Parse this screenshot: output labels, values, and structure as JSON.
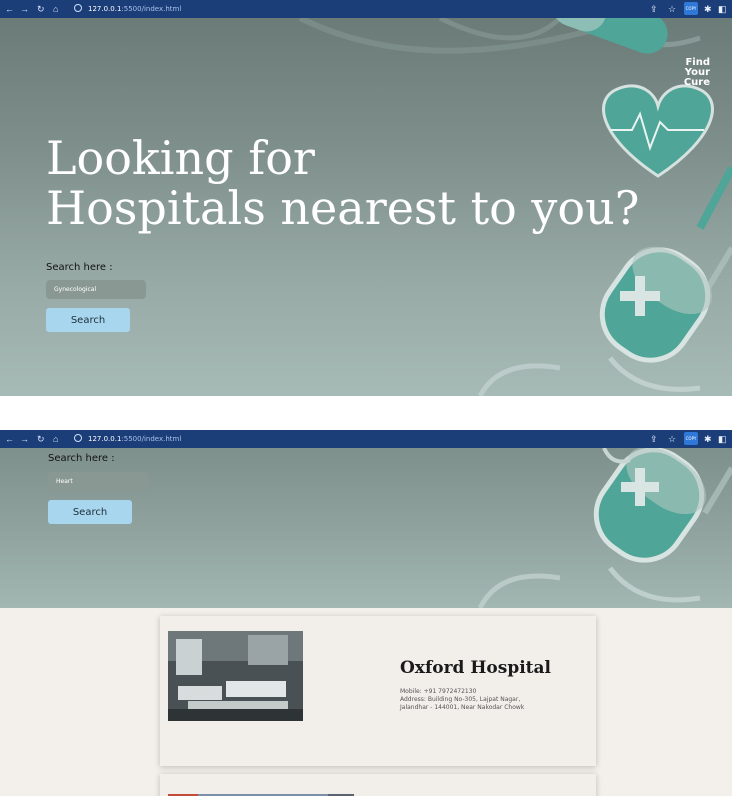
{
  "browser": {
    "url_host": "127.0.0.1",
    "url_path": ":5500/index.html",
    "copy_ext_label": "COPY"
  },
  "brand": {
    "lines": [
      "Find",
      "Your",
      "Cure"
    ]
  },
  "hero": {
    "headline_line1": "Looking for",
    "headline_line2": "Hospitals nearest to you?"
  },
  "search_top": {
    "label": "Search here :",
    "input_value": "Gynecological",
    "button_label": "Search"
  },
  "search_bottom": {
    "label": "Search here :",
    "input_value": "Heart",
    "button_label": "Search"
  },
  "results": [
    {
      "name": "Oxford Hospital",
      "mobile": "Mobile: +91 7972472130",
      "address_line1": "Address: Building No-305, Lajpat Nagar,",
      "address_line2": "Jalandhar - 144001, Near Nakodar Chowk"
    }
  ],
  "colors": {
    "browser_bar": "#1b3d78",
    "accent_teal": "#4fa597",
    "search_button": "#a8d6ee",
    "results_bg": "#f3efeb"
  }
}
